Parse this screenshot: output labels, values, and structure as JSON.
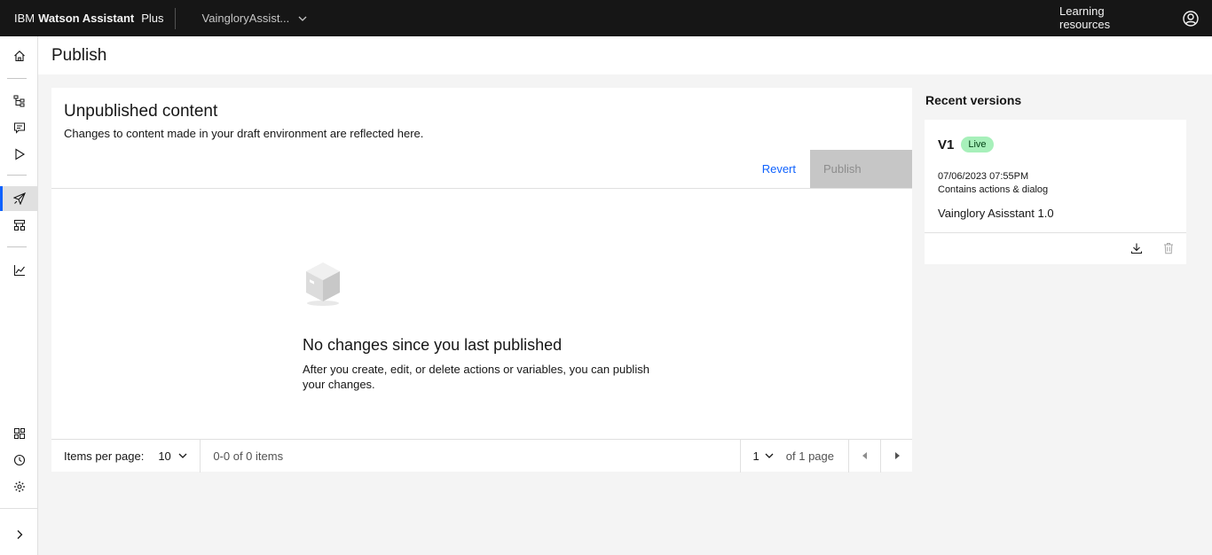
{
  "header": {
    "brand_ibm": "IBM",
    "brand_product": "Watson Assistant",
    "brand_plan": "Plus",
    "assistant_name": "VaingloryAssist...",
    "learning_resources": "Learning resources"
  },
  "sidebar": {
    "items": [
      {
        "name": "home-icon"
      },
      {
        "name": "actions-icon"
      },
      {
        "name": "chat-icon"
      },
      {
        "name": "preview-icon"
      },
      {
        "name": "publish-icon",
        "active": true
      },
      {
        "name": "environments-icon"
      },
      {
        "name": "analytics-icon"
      },
      {
        "name": "integrations-icon"
      },
      {
        "name": "history-icon"
      },
      {
        "name": "settings-icon"
      },
      {
        "name": "expand-icon"
      }
    ]
  },
  "page": {
    "title": "Publish"
  },
  "unpublished": {
    "title": "Unpublished content",
    "subtitle": "Changes to content made in your draft environment are reflected here.",
    "revert_label": "Revert",
    "publish_label": "Publish",
    "empty_title": "No changes since you last published",
    "empty_desc": "After you create, edit, or delete actions or variables, you can publish your changes."
  },
  "pagination": {
    "items_per_page_label": "Items per page:",
    "items_per_page": "10",
    "range": "0-0 of 0 items",
    "page": "1",
    "of_pages": "of 1 page"
  },
  "recent_versions": {
    "title": "Recent versions",
    "versions": [
      {
        "name": "V1",
        "tag": "Live",
        "date": "07/06/2023 07:55PM",
        "contains": "Contains actions & dialog",
        "label": "Vainglory Asisstant 1.0"
      }
    ]
  },
  "colors": {
    "header_bg": "#161616",
    "accent": "#0f62fe",
    "live_tag_bg": "#a7f0ba",
    "disabled_btn": "#c6c6c6"
  }
}
